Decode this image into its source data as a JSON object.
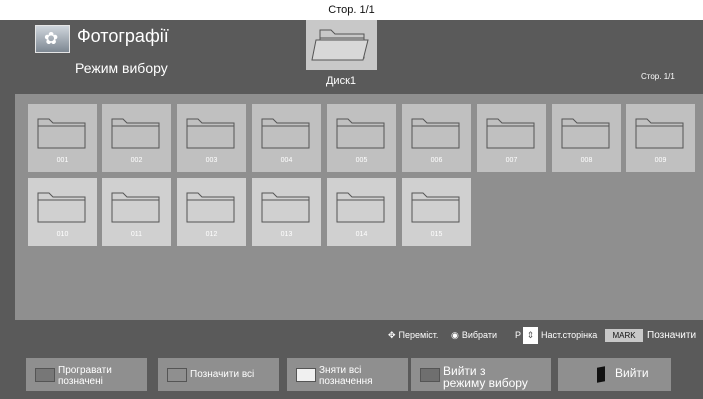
{
  "screen": {
    "page_indicator_top": "Стор. 1/1",
    "app_icon": "photo-icon",
    "app_title": "Фотографії",
    "mode_title": "Режим вибору",
    "disk": {
      "label": "Диск1",
      "icon": "folder-icon"
    },
    "header_page_indicator": "Стор. 1/1"
  },
  "folders": [
    {
      "label": "001"
    },
    {
      "label": "002"
    },
    {
      "label": "003"
    },
    {
      "label": "004"
    },
    {
      "label": "005"
    },
    {
      "label": "006"
    },
    {
      "label": "007"
    },
    {
      "label": "008"
    },
    {
      "label": "009"
    },
    {
      "label": "010"
    },
    {
      "label": "011"
    },
    {
      "label": "012"
    },
    {
      "label": "013"
    },
    {
      "label": "014"
    },
    {
      "label": "015"
    }
  ],
  "nav": {
    "move_icon": "directional-pad-icon",
    "move_label": "Переміст.",
    "select_icon": "ok-button-icon",
    "select_label": "Вибрати",
    "page_key": "P",
    "page_label": "Наст.сторінка",
    "mark_key": "MARK",
    "mark_label": "Позначити"
  },
  "footer": {
    "play_marked_line1": "Програвати",
    "play_marked_line2": "позначені",
    "mark_all": "Позначити всі",
    "unmark_all_line1": "Зняти всі",
    "unmark_all_line2": "позначення",
    "exit_mode_line1": "Вийти з",
    "exit_mode_line2": "режиму вибору",
    "exit": "Вийти"
  },
  "colors": {
    "red_button": "#7a7a7a",
    "green_button": "#8f8f8f",
    "yellow_button": "#f0f0f0",
    "blue_button": "#6f6f6f"
  }
}
